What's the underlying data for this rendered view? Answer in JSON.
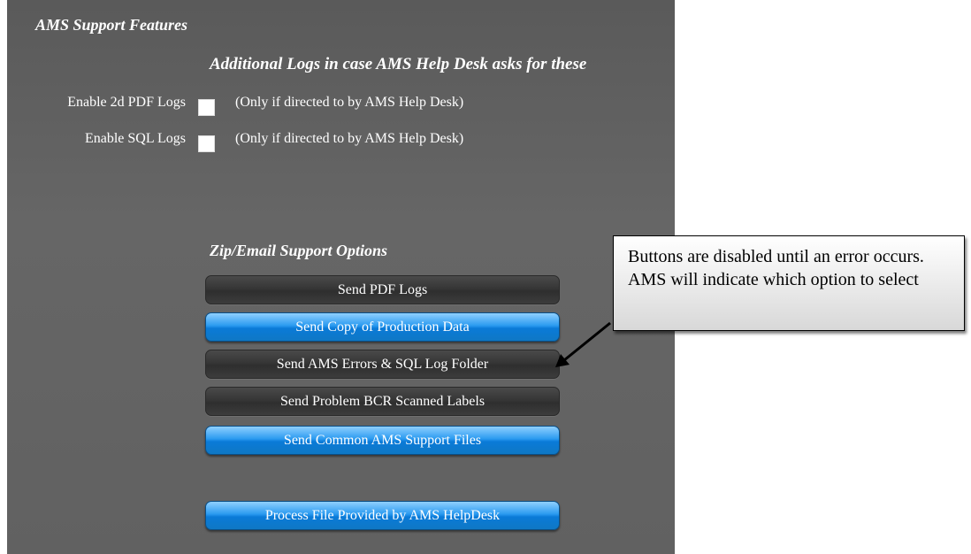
{
  "panel": {
    "title": "AMS Support Features",
    "subtitle": "Additional Logs in case AMS Help Desk asks for these"
  },
  "logs": [
    {
      "label": "Enable 2d PDF Logs",
      "checked": false,
      "note": "(Only if directed to by AMS Help Desk)"
    },
    {
      "label": "Enable SQL Logs",
      "checked": false,
      "note": "(Only if directed to by AMS Help Desk)"
    }
  ],
  "support_options": {
    "title": "Zip/Email Support Options",
    "buttons": [
      {
        "label": "Send PDF Logs",
        "state": "disabled"
      },
      {
        "label": "Send Copy of Production Data",
        "state": "enabled"
      },
      {
        "label": "Send AMS Errors & SQL Log Folder",
        "state": "disabled"
      },
      {
        "label": "Send Problem BCR Scanned Labels",
        "state": "disabled"
      },
      {
        "label": "Send Common AMS Support Files",
        "state": "enabled"
      }
    ],
    "process_button": {
      "label": "Process File Provided by AMS HelpDesk",
      "state": "enabled"
    }
  },
  "callout": {
    "text": "Buttons are disabled until an error occurs. AMS will indicate which option to select"
  }
}
